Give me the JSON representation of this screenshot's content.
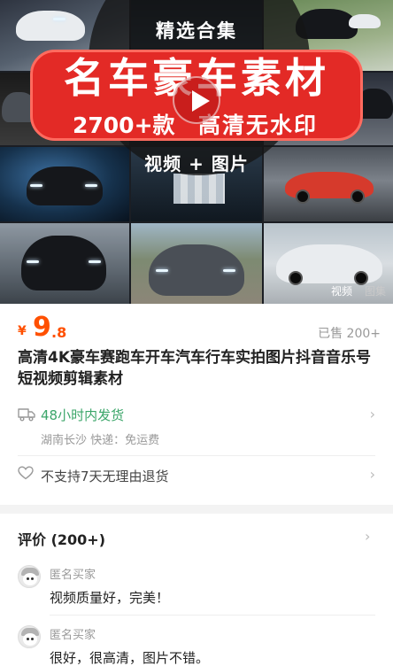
{
  "banner": {
    "top_text": "精选合集",
    "main_text": "名车豪车素材",
    "count_text": "2700+款",
    "hd_text": "高清无水印",
    "bottom_text": "视频 + 图片",
    "media_tabs": [
      "视频",
      "图集"
    ]
  },
  "product": {
    "currency": "¥",
    "price_int": "9",
    "price_dec": ".8",
    "sold": "已售 200+",
    "title": "高清4K豪车赛跑车开车汽车行车实拍图片抖音音乐号短视频剪辑素材"
  },
  "shipping": {
    "headline": "48小时内发货",
    "detail": "湖南长沙  快递：免运费",
    "icon": "truck-icon"
  },
  "returns": {
    "text": "不支持7天无理由退货",
    "icon": "heart-icon"
  },
  "reviews": {
    "header": "评价 (200+)",
    "items": [
      {
        "name": "匿名买家",
        "text": "视频质量好，完美！"
      },
      {
        "name": "匿名买家",
        "text": "很好，很高清，图片不错。"
      }
    ]
  },
  "colors": {
    "accent": "#ff5000",
    "banner_red": "#e32a26",
    "ship_green": "#3ca66a"
  }
}
